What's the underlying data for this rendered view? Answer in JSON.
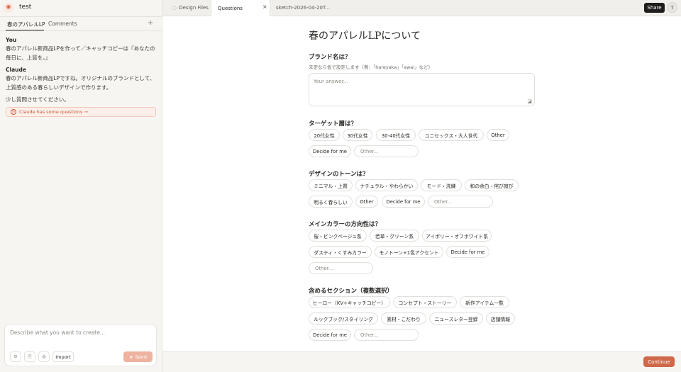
{
  "project": {
    "title": "test"
  },
  "sidebar": {
    "tabs": [
      "春のアパレルLP",
      "Comments"
    ],
    "messages": [
      {
        "sender": "You",
        "lines": [
          "春のアパレル新商品LPを作って／キャッチコピーは『あなたの",
          "毎日に、上質を。』"
        ]
      },
      {
        "sender": "Claude",
        "lines": [
          "春のアパレル新商品LPですね。オリジナルのブランドとして、",
          "上質感のある春らしいデザインで作ります。"
        ]
      }
    ],
    "follow_up": "少し質問させてください。",
    "notice": "Claude has some questions →"
  },
  "composer": {
    "placeholder": "Describe what you want to create...",
    "import_label": "Import",
    "send_label": "Send"
  },
  "tabs": [
    {
      "label": "Design Files"
    },
    {
      "label": "Questions"
    },
    {
      "label": "sketch-2026-04-20T..."
    }
  ],
  "header": {
    "share_label": "Share",
    "avatar_initial": "T"
  },
  "page": {
    "title": "春のアパレルLPについて"
  },
  "questions": {
    "brand": {
      "title": "ブランド名は？",
      "hint": "未定なら仮で設定します（例：「hareyaka」「awai」など）",
      "placeholder": "Your answer..."
    },
    "target": {
      "title": "ターゲット層は？",
      "options": [
        "20代女性",
        "30代女性",
        "30-40代女性",
        "ユニセックス・大人世代",
        "Other",
        "Decide for me"
      ],
      "other_placeholder": "Other..."
    },
    "tone": {
      "title": "デザインのトーンは？",
      "options": [
        "ミニマル・上質",
        "ナチュラル・やわらかい",
        "モード・洗練",
        "和の余白・侘び寂び",
        "明るく春らしい",
        "Other",
        "Decide for me"
      ],
      "other_placeholder": "Other..."
    },
    "color": {
      "title": "メインカラーの方向性は？",
      "options": [
        "桜・ピンクベージュ系",
        "若草・グリーン系",
        "アイボリー・オフホワイト系",
        "ダスティ・くすみカラー",
        "モノトーン+1色アクセント",
        "Decide for me"
      ],
      "other_placeholder": "Other..."
    },
    "sections": {
      "title": "含めるセクション（複数選択）",
      "options": [
        "ヒーロー（KV+キャッチコピー）",
        "コンセプト・ストーリー",
        "新作アイテム一覧",
        "ルックブック/スタイリング",
        "素材・こだわり",
        "ニュースレター登録",
        "店舗情報",
        "Decide for me"
      ],
      "other_placeholder": "Other..."
    }
  },
  "footer": {
    "continue_label": "Continue"
  },
  "colors": {
    "accent": "#d0694a",
    "send_disabled": "#eeb3a0",
    "share_bg": "#1f1e1c"
  }
}
